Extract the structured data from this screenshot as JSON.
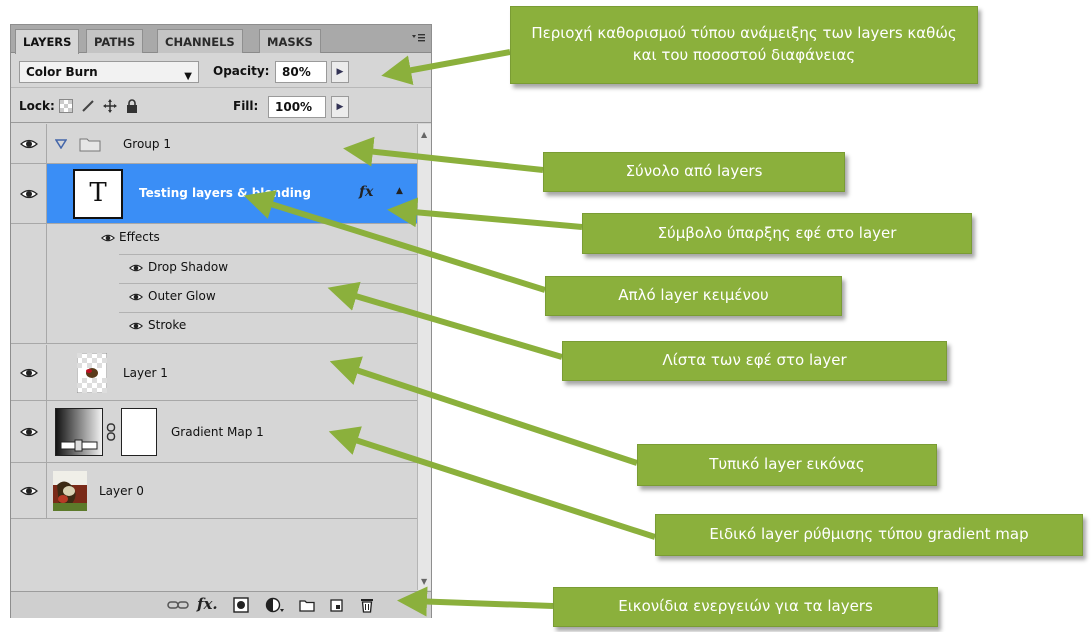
{
  "panel": {
    "tabs": [
      "LAYERS",
      "PATHS",
      "CHANNELS",
      "MASKS"
    ],
    "active_tab": "LAYERS",
    "blend_mode": "Color Burn",
    "opacity_label": "Opacity:",
    "opacity_value": "80%",
    "lock_label": "Lock:",
    "fill_label": "Fill:",
    "fill_value": "100%"
  },
  "layers": {
    "group": "Group 1",
    "text_layer_thumb": "T",
    "text_layer": "Testing layers & blending",
    "fx_badge": "fx",
    "effects_label": "Effects",
    "effects": [
      "Drop Shadow",
      "Outer Glow",
      "Stroke"
    ],
    "layer1": "Layer 1",
    "gradient_map": "Gradient Map 1",
    "layer0": "Layer 0"
  },
  "bottom_icons": [
    "link-icon",
    "fx-icon",
    "mask-icon",
    "adjustment-icon",
    "folder-icon",
    "new-layer-icon",
    "trash-icon"
  ],
  "bottom_fx_label": "fx.",
  "callouts": {
    "blend": "Περιοχή καθορισμού τύπου ανάμειξης των layers καθώς και του ποσοστού διαφάνειας",
    "group": "Σύνολο από layers",
    "fx_symbol": "Σύμβολο ύπαρξης εφέ στο layer",
    "text_layer": "Απλό layer κειμένου",
    "effects_list": "Λίστα των εφέ στο layer",
    "image_layer": "Τυπικό layer εικόνας",
    "gradient_layer": "Ειδικό layer ρύθμισης τύπου gradient map",
    "actions": "Εικονίδια ενεργειών για τα layers"
  },
  "colors": {
    "callout_bg": "#8bb03c",
    "selection": "#3a8ef6",
    "panel_bg": "#d6d6d6"
  }
}
